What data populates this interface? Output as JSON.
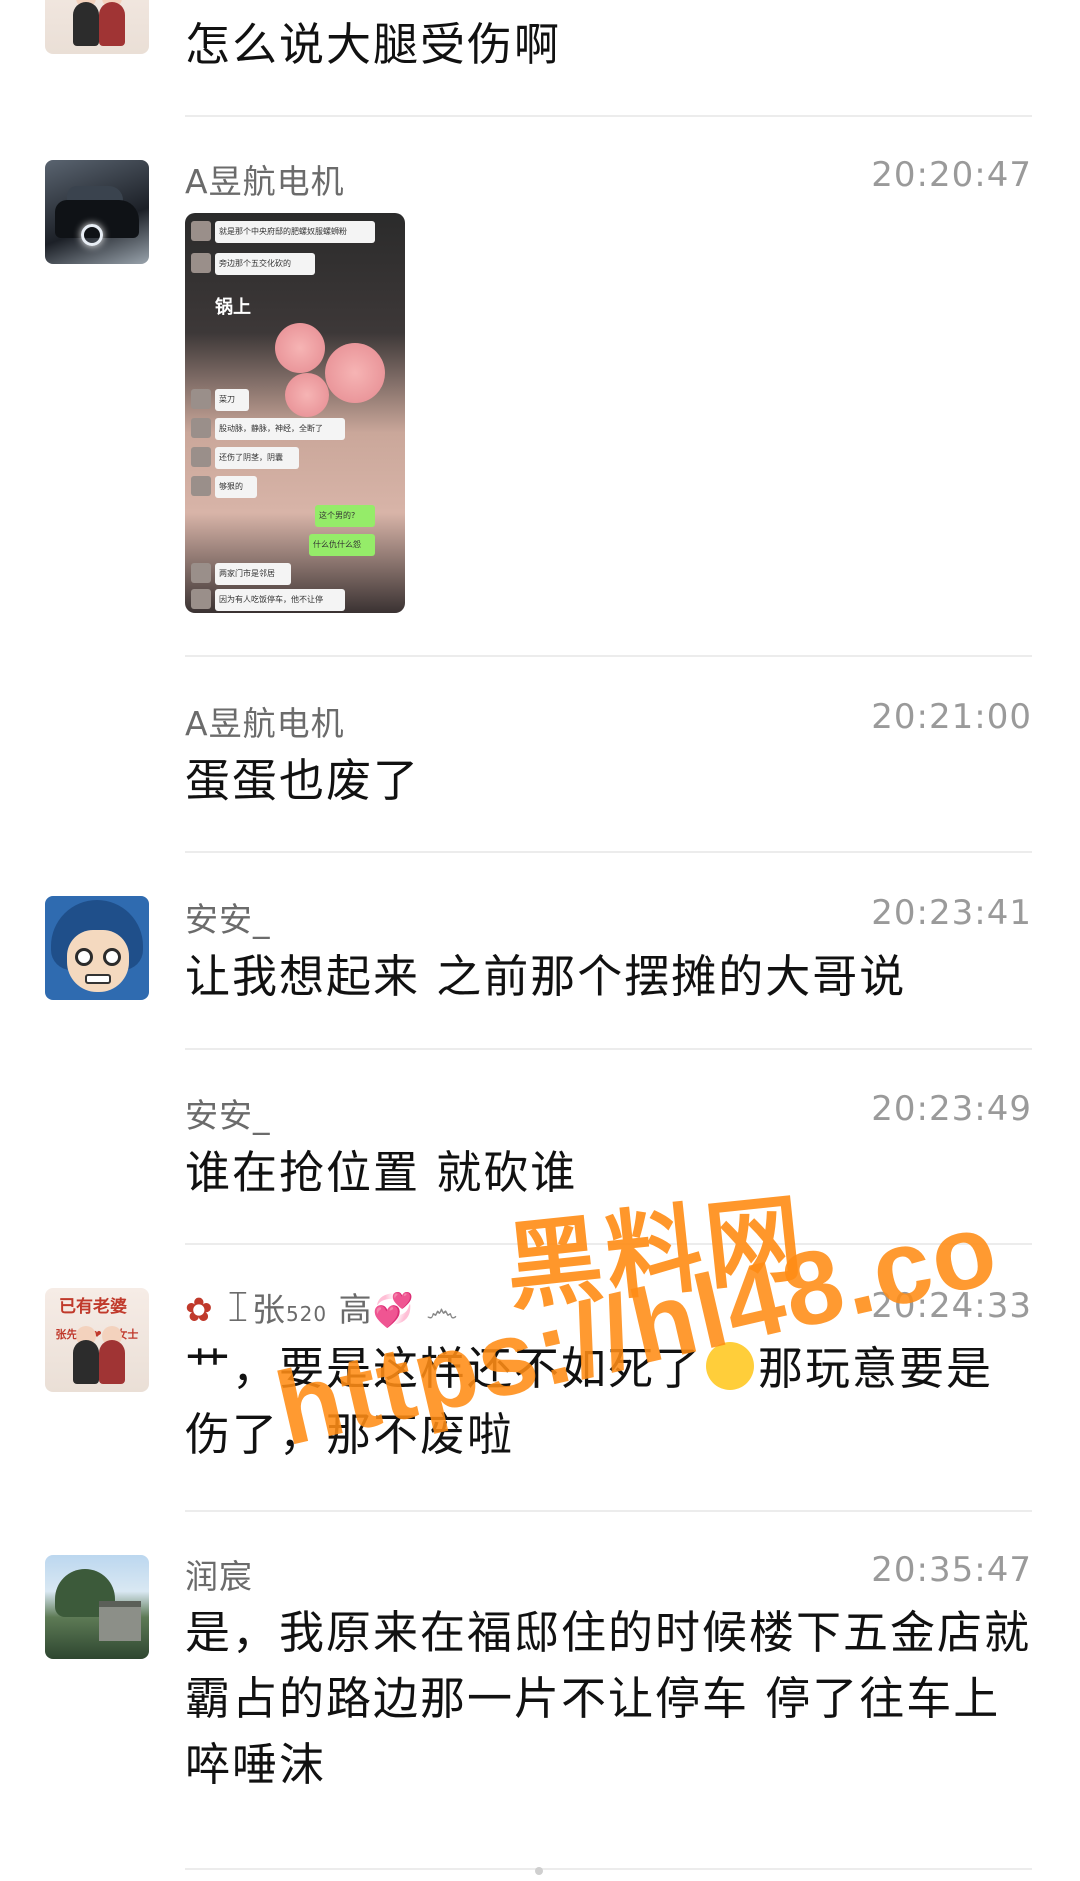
{
  "messages": [
    {
      "id": "m0",
      "sender": "",
      "time": "",
      "text": "怎么说大腿受伤啊",
      "avatar": "couple-avatar"
    },
    {
      "id": "m1",
      "sender": "A昱航电机",
      "time": "20:20:47",
      "image": {
        "bubbles": [
          "就是那个中央府邸的肥螺奴服螺蛳粉",
          "旁边那个五交化砍的",
          "菜刀",
          "股动脉，静脉，神经，全断了",
          "还伤了阴茎，阴囊",
          "够狠的",
          "这个男的?",
          "什么仇什么怨",
          "两家门市是邻居",
          "因为有人吃饭停车，他不让停"
        ],
        "sign_text": "锅上"
      },
      "avatar": "car-avatar"
    },
    {
      "id": "m2",
      "sender": "A昱航电机",
      "time": "20:21:00",
      "text": "蛋蛋也废了"
    },
    {
      "id": "m3",
      "sender": "安安_",
      "time": "20:23:41",
      "text": "让我想起来 之前那个摆摊的大哥说",
      "avatar": "anime-avatar"
    },
    {
      "id": "m4",
      "sender": "安安_",
      "time": "20:23:49",
      "text": "谁在抢位置 就砍谁"
    },
    {
      "id": "m5",
      "sender_parts": [
        "ꀤ张",
        "520",
        "高"
      ],
      "time": "20:24:33",
      "text_before": "艹，要是这样还不如死了",
      "text_after": "那玩意要是伤了，那不废啦",
      "avatar": "couple-avatar",
      "avatar_label": "已有老婆"
    },
    {
      "id": "m6",
      "sender": "润宸",
      "time": "20:35:47",
      "text": "是，我原来在福邸住的时候楼下五金店就霸占的路边那一片不让停车 停了往车上啐唾沫",
      "avatar": "nature-avatar"
    }
  ],
  "couple_avatar_banner": "张先生 ❤ 高女士",
  "watermark": {
    "title": "黑料网",
    "url": "https://hl48.co"
  }
}
